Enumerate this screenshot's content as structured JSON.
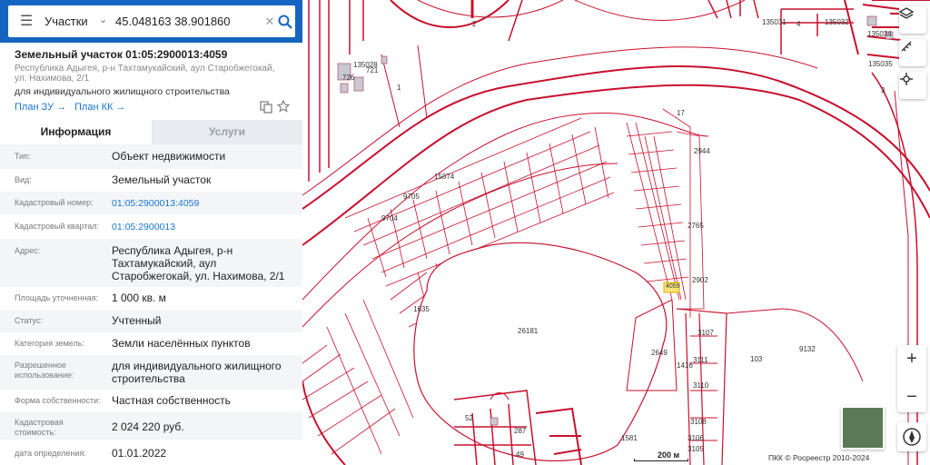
{
  "search": {
    "scope": "Участки",
    "query": "45.048163 38.901860"
  },
  "parcel": {
    "title": "Земельный участок 01:05:2900013:4059",
    "address": "Республика Адыгея, р-н Тахтамукайский, аул Старобжегокай, ул. Нахимова, 2/1",
    "purpose": "для индивидуального жилищного строительства",
    "plan_zu": "План ЗУ",
    "plan_kk": "План КК"
  },
  "tabs": {
    "info": "Информация",
    "services": "Услуги"
  },
  "attributes": [
    {
      "key": "Тип:",
      "value": "Объект недвижимости"
    },
    {
      "key": "Вид:",
      "value": "Земельный участок"
    },
    {
      "key": "Кадастровый номер:",
      "value": "01:05:2900013:4059"
    },
    {
      "key": "Кадастровый квартал:",
      "value": "01:05:2900013"
    },
    {
      "key": "Адрес:",
      "value": "Республика Адыгея, р-н Тахтамукайский, аул Старобжегокай, ул. Нахимова, 2/1"
    },
    {
      "key": "Площадь уточненная:",
      "value": "1 000 кв. м"
    },
    {
      "key": "Статус:",
      "value": "Учтенный"
    },
    {
      "key": "Категория земель:",
      "value": "Земли населённых пунктов"
    },
    {
      "key": "Разрешенное использование:",
      "value": "для индивидуального жилищного строительства"
    },
    {
      "key": "Форма собственности:",
      "value": "Частная собственность"
    },
    {
      "key": "Кадастровая стоимость:",
      "value": "2 024 220 руб."
    },
    {
      "key": "дата определения:",
      "value": "01.01.2022"
    }
  ],
  "map": {
    "labels": [
      "135028",
      "726",
      "721",
      "1",
      "2",
      "17",
      "135031",
      "135032",
      "135034",
      "135035",
      "3",
      "4",
      "2944",
      "2765",
      "2902",
      "26181",
      "2649",
      "3107",
      "3111",
      "3110",
      "3108",
      "3106",
      "3105",
      "103",
      "9132",
      "1581",
      "1635",
      "287",
      "49",
      "52",
      "9704",
      "9705",
      "15874",
      "1416",
      "4059"
    ],
    "scale": "200 м",
    "copyright": "ПКК © Росреестр 2010-2024",
    "accent": "#d0021b"
  },
  "colors": {
    "header": "#1565c0",
    "link": "#1976d2",
    "parcel_line": "#c8102e"
  }
}
